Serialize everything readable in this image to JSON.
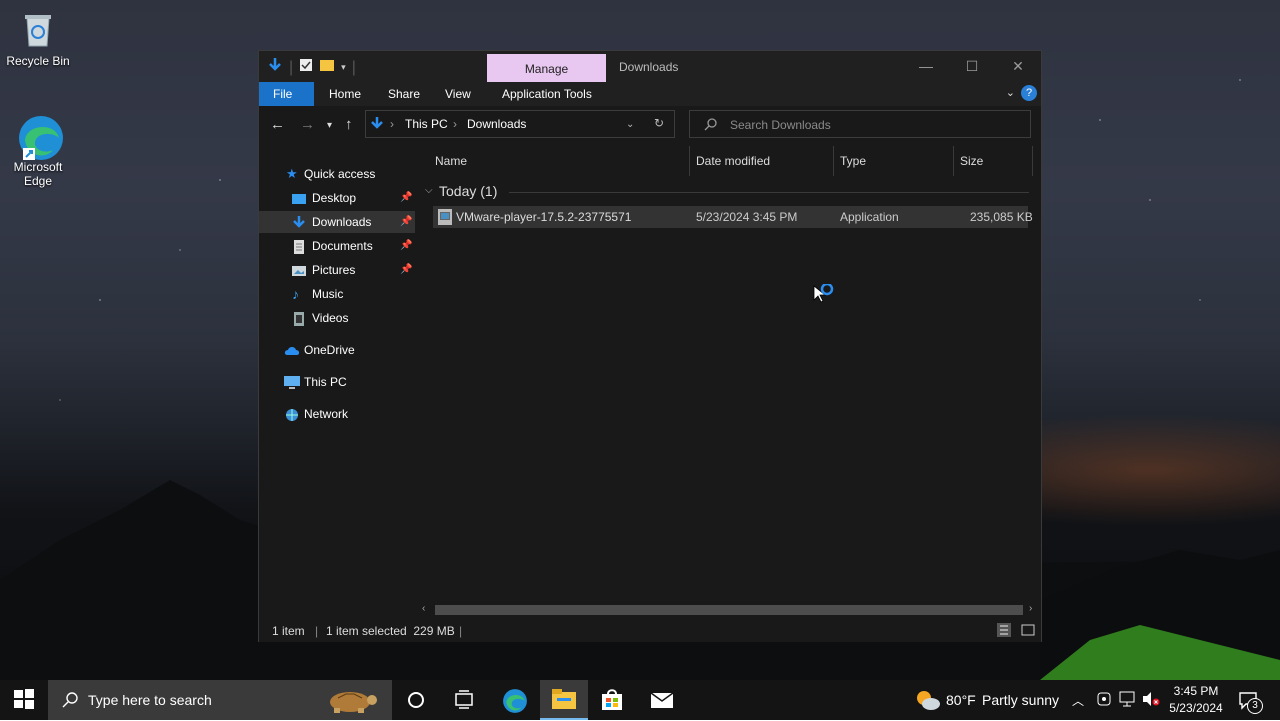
{
  "desktop": {
    "icons": [
      {
        "label": "Recycle Bin",
        "icon": "recycle-bin-icon"
      },
      {
        "label": "Microsoft Edge",
        "icon": "edge-icon"
      }
    ]
  },
  "window": {
    "ribbon_context_tab": "Manage",
    "title": "Downloads",
    "ribbon_tabs": [
      "File",
      "Home",
      "Share",
      "View",
      "Application Tools"
    ],
    "address": {
      "segments": [
        "This PC",
        "Downloads"
      ]
    },
    "search": {
      "placeholder": "Search Downloads"
    },
    "nav_pane": {
      "quick_access": "Quick access",
      "pinned": [
        "Desktop",
        "Downloads",
        "Documents",
        "Pictures"
      ],
      "items": [
        "Music",
        "Videos"
      ],
      "onedrive": "OneDrive",
      "this_pc": "This PC",
      "network": "Network"
    },
    "columns": [
      "Name",
      "Date modified",
      "Type",
      "Size"
    ],
    "group": "Today (1)",
    "files": [
      {
        "name": "VMware-player-17.5.2-23775571",
        "date": "5/23/2024 3:45 PM",
        "type": "Application",
        "size": "235,085 KB"
      }
    ],
    "status": {
      "count": "1 item",
      "selected": "1 item selected  229 MB"
    }
  },
  "taskbar": {
    "search_placeholder": "Type here to search",
    "weather": {
      "temp": "80°F",
      "desc": "Partly sunny"
    },
    "time": "3:45 PM",
    "date": "5/23/2024",
    "notification_count": "3"
  },
  "colors": {
    "accent": "#1a73c9",
    "manage_tab": "#e8c8f0",
    "window_bg": "#191919"
  }
}
